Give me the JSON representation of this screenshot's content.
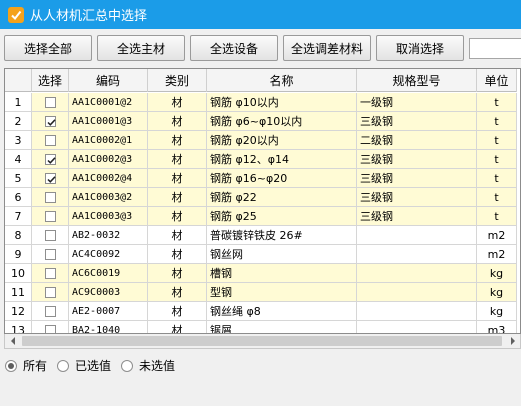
{
  "window": {
    "title": "从人材机汇总中选择"
  },
  "toolbar": {
    "select_all": "选择全部",
    "select_main": "全选主材",
    "select_equipment": "全选设备",
    "select_price_diff": "全选调差材料",
    "deselect": "取消选择"
  },
  "table": {
    "headers": {
      "index": "",
      "select": "选择",
      "code": "编码",
      "category": "类别",
      "name": "名称",
      "spec": "规格型号",
      "unit": "单位"
    },
    "rows": [
      {
        "index": "1",
        "checked": false,
        "code": "AA1C0001@2",
        "category": "材",
        "name": "钢筋 φ10以内",
        "spec": "一级钢",
        "unit": "t"
      },
      {
        "index": "2",
        "checked": true,
        "code": "AA1C0001@3",
        "category": "材",
        "name": "钢筋 φ6~φ10以内",
        "spec": "三级钢",
        "unit": "t"
      },
      {
        "index": "3",
        "checked": false,
        "code": "AA1C0002@1",
        "category": "材",
        "name": "钢筋 φ20以内",
        "spec": "二级钢",
        "unit": "t"
      },
      {
        "index": "4",
        "checked": true,
        "code": "AA1C0002@3",
        "category": "材",
        "name": "钢筋 φ12、φ14",
        "spec": "三级钢",
        "unit": "t"
      },
      {
        "index": "5",
        "checked": true,
        "code": "AA1C0002@4",
        "category": "材",
        "name": "钢筋 φ16~φ20",
        "spec": "三级钢",
        "unit": "t"
      },
      {
        "index": "6",
        "checked": false,
        "code": "AA1C0003@2",
        "category": "材",
        "name": "钢筋 φ22",
        "spec": "三级钢",
        "unit": "t"
      },
      {
        "index": "7",
        "checked": false,
        "code": "AA1C0003@3",
        "category": "材",
        "name": "钢筋 φ25",
        "spec": "三级钢",
        "unit": "t"
      },
      {
        "index": "8",
        "checked": false,
        "code": "AB2-0032",
        "category": "材",
        "name": "普碳镀锌铁皮 26#",
        "spec": "",
        "unit": "m2"
      },
      {
        "index": "9",
        "checked": false,
        "code": "AC4C0092",
        "category": "材",
        "name": "钢丝网",
        "spec": "",
        "unit": "m2"
      },
      {
        "index": "10",
        "checked": false,
        "code": "AC6C0019",
        "category": "材",
        "name": "槽钢",
        "spec": "",
        "unit": "kg"
      },
      {
        "index": "11",
        "checked": false,
        "code": "AC9C0003",
        "category": "材",
        "name": "型钢",
        "spec": "",
        "unit": "kg"
      },
      {
        "index": "12",
        "checked": false,
        "code": "AE2-0007",
        "category": "材",
        "name": "钢丝绳 φ8",
        "spec": "",
        "unit": "kg"
      },
      {
        "index": "13",
        "checked": false,
        "code": "BA2-1040",
        "category": "材",
        "name": "锯屑",
        "spec": "",
        "unit": "m3"
      }
    ]
  },
  "filter": {
    "options": [
      {
        "label": "所有",
        "selected": true
      },
      {
        "label": "已选值",
        "selected": false
      },
      {
        "label": "未选值",
        "selected": false
      }
    ]
  },
  "colors": {
    "title_bar": "#1b9ce8",
    "row_highlight": "#fffbd5",
    "app_icon": "#f4a21b"
  }
}
